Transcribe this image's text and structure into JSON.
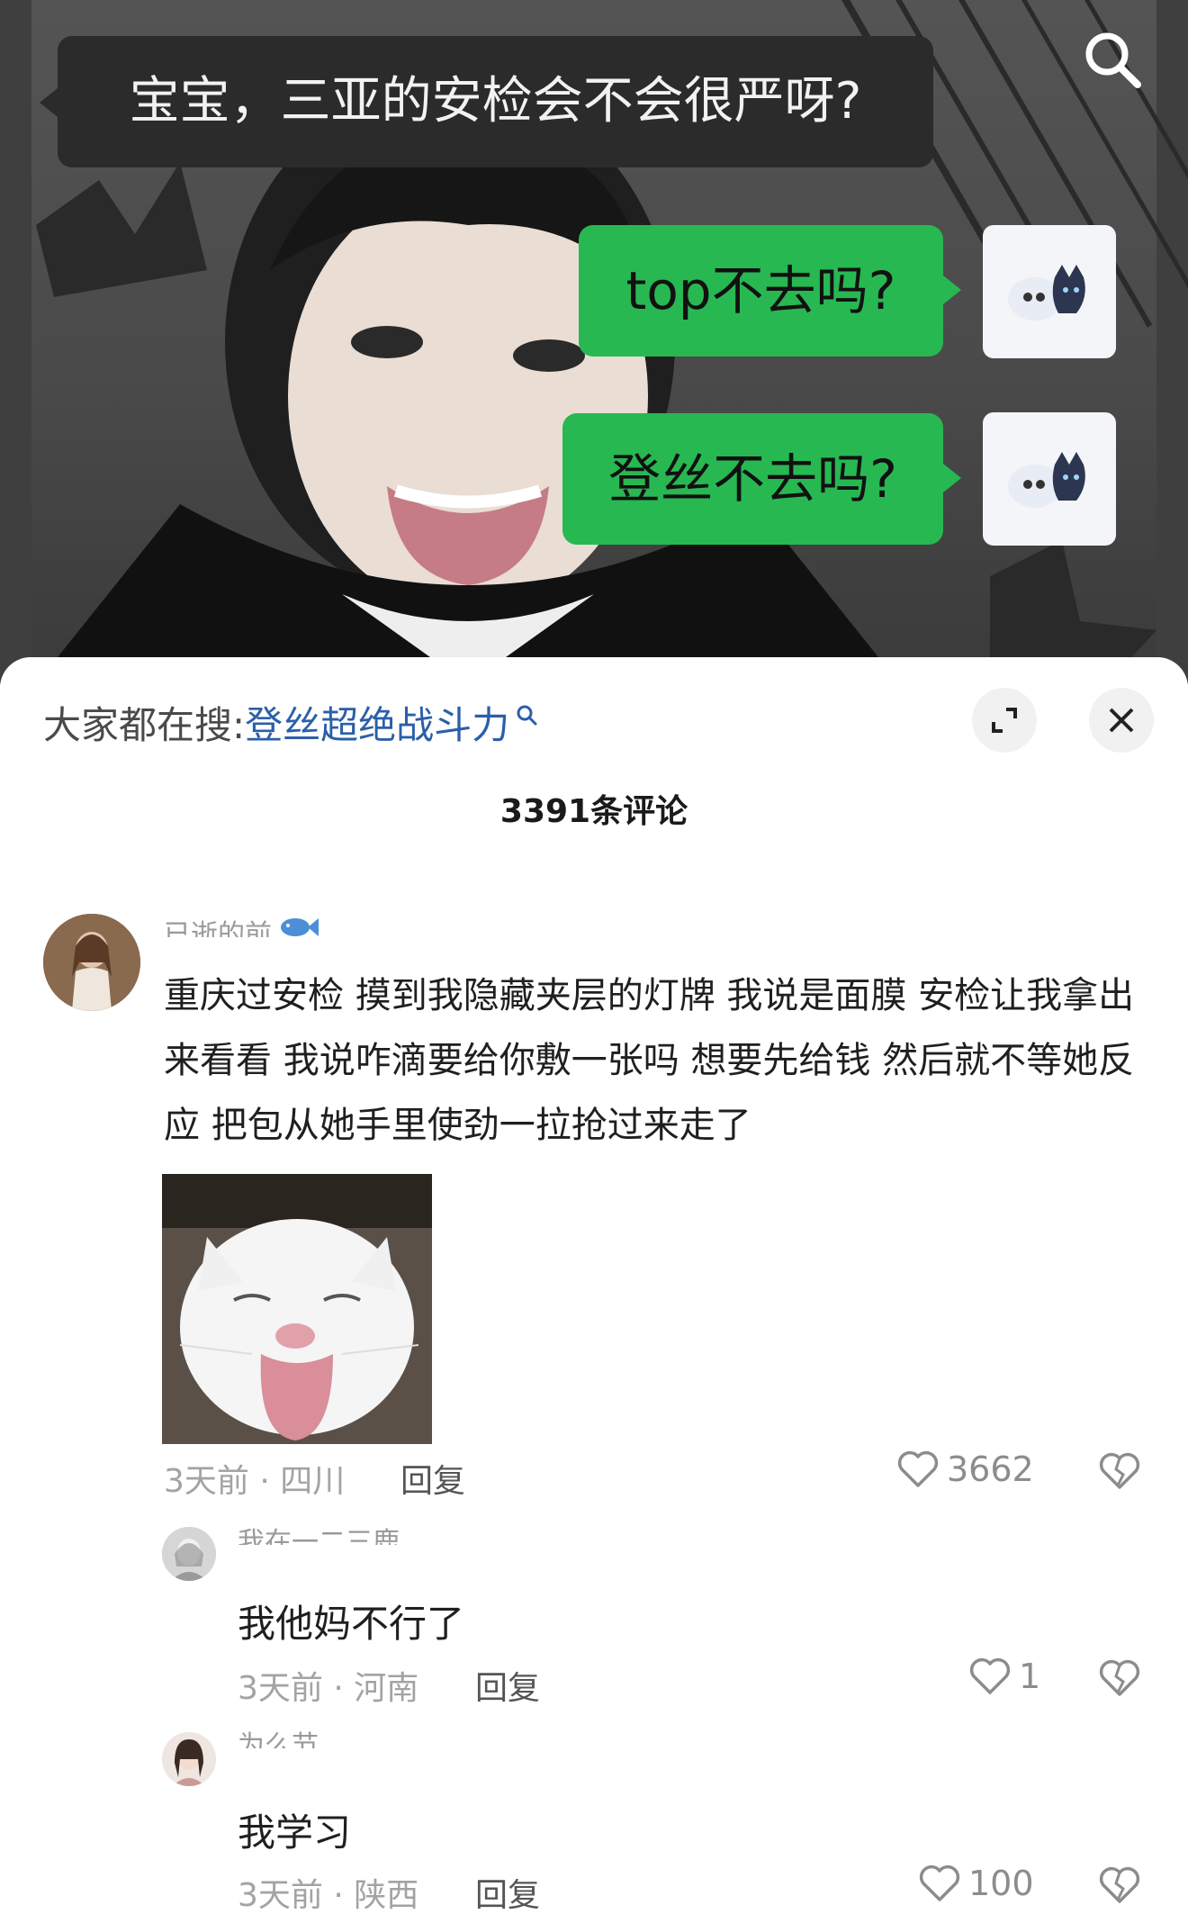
{
  "video": {
    "caption_top": "宝宝，三亚的安检会不会很严呀?",
    "reply_1": "top不去吗?",
    "reply_2": "登丝不去吗?"
  },
  "sheet": {
    "hot_search_prefix": "大家都在搜:",
    "hot_search_term": "登丝超绝战斗力",
    "comment_count": "3391条评论"
  },
  "comment": {
    "username": "已逝的前",
    "text": "重庆过安检 摸到我隐藏夹层的灯牌 我说是面膜 安检让我拿出来看看 我说咋滴要给你敷一张吗 想要先给钱 然后就不等她反应 把包从她手里使劲一拉抢过来走了",
    "meta": "3天前 · 四川",
    "reply_label": "回复",
    "likes": "3662"
  },
  "replies": [
    {
      "username": "我在一二三鹿",
      "text": "我他妈不行了",
      "meta": "3天前 · 河南",
      "reply_label": "回复",
      "likes": "1"
    },
    {
      "username": "为么节",
      "text": "我学习",
      "meta": "3天前 · 陕西",
      "reply_label": "回复",
      "likes": "100"
    }
  ],
  "colors": {
    "green_bubble": "#27b852",
    "link_blue": "#2b5fa8",
    "muted_text": "#a3a3a3"
  },
  "icons": [
    "search-icon",
    "expand-icon",
    "close-icon",
    "heart-icon",
    "broken-heart-icon",
    "fish-badge-icon"
  ]
}
